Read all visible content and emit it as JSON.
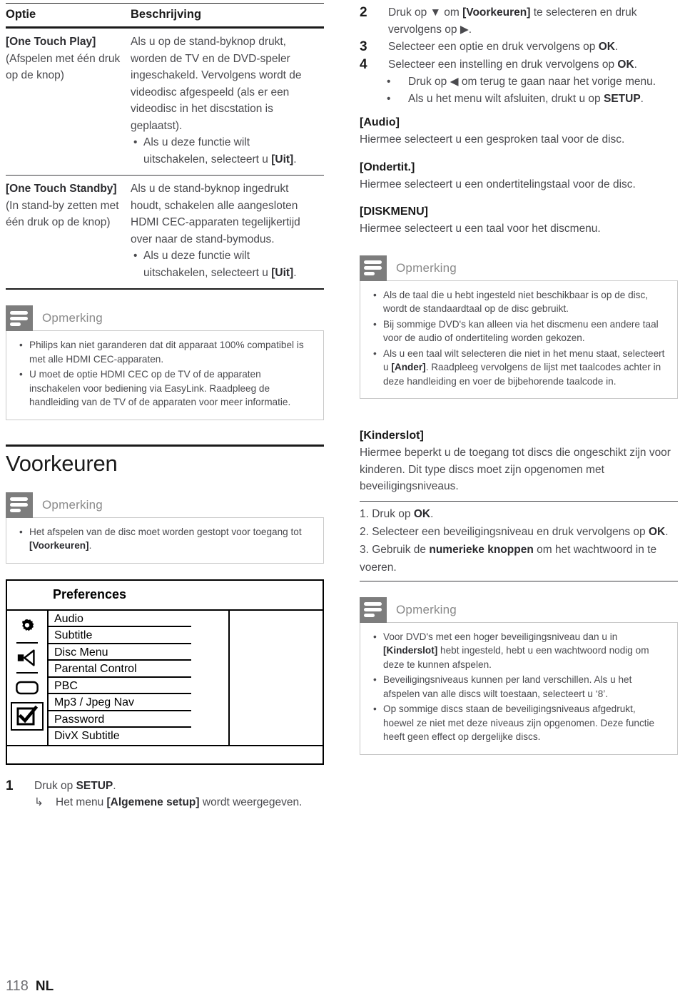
{
  "table": {
    "headers": [
      "Optie",
      "Beschrijving"
    ],
    "rows": [
      {
        "option_bold": "[One Touch Play]",
        "option_rest": "(Afspelen met één druk op de knop)",
        "desc_para": "Als u op de stand-byknop drukt, worden de TV en de DVD-speler ingeschakeld. Vervolgens wordt de videodisc afgespeeld (als er een videodisc in het discstation is geplaatst).",
        "desc_bullets": [
          {
            "text_before": "Als u deze functie wilt uitschakelen, selecteert u ",
            "text_bold": "[Uit]",
            "text_after": "."
          }
        ]
      },
      {
        "option_bold": "[One Touch Standby]",
        "option_rest": "(In stand-by zetten met één druk op de knop)",
        "desc_para": "Als u de stand-byknop ingedrukt houdt, schakelen alle aangesloten HDMI CEC-apparaten tegelijkertijd over naar de stand-bymodus.",
        "desc_bullets": [
          {
            "text_before": "Als u deze functie wilt uitschakelen, selecteert u ",
            "text_bold": "[Uit]",
            "text_after": "."
          }
        ]
      }
    ]
  },
  "note_hdmi": {
    "icon_name": "note-icon",
    "title": "Opmerking",
    "bullets": [
      "Philips kan niet garanderen dat dit apparaat 100% compatibel is met alle HDMI CEC-apparaten.",
      "U moet de optie HDMI CEC op de TV of de apparaten inschakelen voor bediening via EasyLink. Raadpleeg de handleiding van de TV of de apparaten voor meer informatie."
    ]
  },
  "section_voorkeuren": {
    "title": "Voorkeuren",
    "note": {
      "title": "Opmerking",
      "bullet_before": "Het afspelen van de disc moet worden gestopt voor toegang tot ",
      "bullet_bold": "[Voorkeuren]",
      "bullet_after": "."
    }
  },
  "osd_menu": {
    "title": "Preferences",
    "sidebar_icons": [
      "gear-icon",
      "speaker-icon",
      "display-icon",
      "checkbox-checked-icon"
    ],
    "selected_icon_index": 3,
    "items": [
      "Audio",
      "Subtitle",
      "Disc Menu",
      "Parental Control",
      "PBC",
      "Mp3 / Jpeg Nav",
      "Password",
      "DivX Subtitle"
    ]
  },
  "step1": {
    "num": "1",
    "text_before": "Druk op ",
    "text_bold": "SETUP",
    "text_after": ".",
    "sub_arrow": "↳",
    "sub_before": "Het menu ",
    "sub_bold": "[Algemene setup]",
    "sub_after": " wordt weergegeven."
  },
  "steps_right": [
    {
      "num": "2",
      "before": "Druk op ",
      "sym": "▼",
      "mid": " om ",
      "bold": "[Voorkeuren]",
      "mid2": " te selecteren en druk vervolgens op ",
      "sym2": "▶",
      "after": "."
    },
    {
      "num": "3",
      "before": "Selecteer een optie en druk vervolgens op ",
      "bold": "OK",
      "after": "."
    },
    {
      "num": "4",
      "before": "Selecteer een instelling en druk vervolgens op ",
      "bold": "OK",
      "after": "."
    }
  ],
  "step4_bullets": [
    {
      "before": "Druk op ",
      "sym": "◀",
      "after": " om terug te gaan naar het vorige menu.",
      "bold": ""
    },
    {
      "before": "Als u het menu wilt afsluiten, drukt u op ",
      "sym": "",
      "bold": "SETUP",
      "after": "."
    }
  ],
  "definitions": [
    {
      "term": "[Audio]",
      "desc": "Hiermee selecteert u een gesproken taal voor de disc."
    },
    {
      "term": "[Ondertit.]",
      "desc": "Hiermee selecteert u een ondertitelingstaal voor de disc."
    },
    {
      "term": "[DISKMENU]",
      "desc": "Hiermee selecteert u een taal voor het discmenu."
    }
  ],
  "note_taal": {
    "title": "Opmerking",
    "bullets": [
      {
        "before": "Als de taal die u hebt ingesteld niet beschikbaar is op de disc, wordt de standaardtaal op de disc gebruikt.",
        "bold": "",
        "after": ""
      },
      {
        "before": "Bij sommige DVD's kan alleen via het discmenu een andere taal voor de audio of ondertiteling worden gekozen.",
        "bold": "",
        "after": ""
      },
      {
        "before": "Als u een taal wilt selecteren die niet in het menu staat, selecteert u ",
        "bold": "[Ander]",
        "after": ". Raadpleeg vervolgens de lijst met taalcodes achter in deze handleiding en voer de bijbehorende taalcode in."
      }
    ]
  },
  "kinderslot": {
    "term": "[Kinderslot]",
    "desc": "Hiermee beperkt u de toegang tot discs die ongeschikt zijn voor kinderen. Dit type discs moet zijn opgenomen met beveiligingsniveaus.",
    "numbered": [
      {
        "before": "1. Druk op ",
        "bold": "OK",
        "after": "."
      },
      {
        "before": "2. Selecteer een beveiligingsniveau en druk vervolgens op ",
        "bold": "OK",
        "after": "."
      },
      {
        "before": "3. Gebruik de ",
        "bold": "numerieke knoppen",
        "after": " om het wachtwoord in te voeren."
      }
    ]
  },
  "note_kinderslot": {
    "title": "Opmerking",
    "bullets": [
      {
        "before": "Voor DVD's met een hoger beveiligingsniveau dan u in ",
        "bold": "[Kinderslot]",
        "after": " hebt ingesteld, hebt u een wachtwoord nodig om deze te kunnen afspelen."
      },
      {
        "before": "Beveiligingsniveaus kunnen per land verschillen. Als u het afspelen van alle discs wilt toestaan, selecteert u ‘8’.",
        "bold": "",
        "after": ""
      },
      {
        "before": "Op sommige discs staan de beveiligingsniveaus afgedrukt, hoewel ze niet met deze niveaus zijn opgenomen. Deze functie heeft geen effect op dergelijke discs.",
        "bold": "",
        "after": ""
      }
    ]
  },
  "footer": {
    "page": "118",
    "language": "NL"
  },
  "colors": {
    "note_icon_bg": "#7d7d7d",
    "note_title": "#8a8a8a",
    "body_text": "#4a4a4e",
    "heading": "#1a1a1a"
  }
}
